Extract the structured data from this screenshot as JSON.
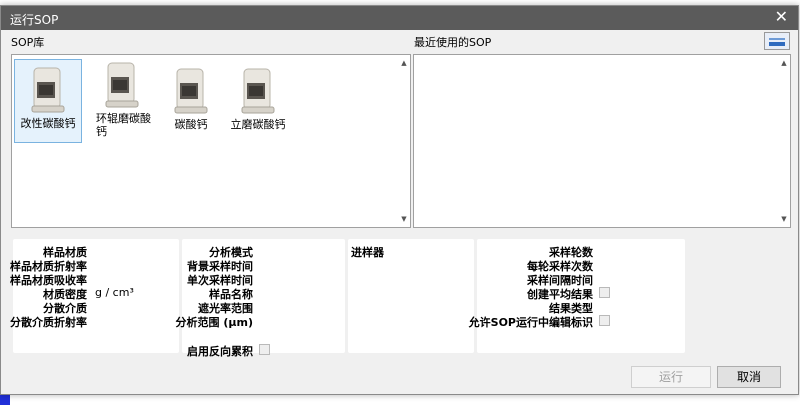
{
  "dialog": {
    "title": "运行SOP",
    "close_glyph": "✕"
  },
  "library": {
    "label": "SOP库",
    "items": [
      {
        "label": "改性碳酸钙",
        "icon": "instrument-icon",
        "selected": true
      },
      {
        "label": "环辊磨碳酸钙",
        "icon": "instrument-icon",
        "selected": false
      },
      {
        "label": "碳酸钙",
        "icon": "instrument-icon",
        "selected": false
      },
      {
        "label": "立磨碳酸钙",
        "icon": "instrument-icon",
        "selected": false
      }
    ]
  },
  "recent": {
    "label": "最近使用的SOP"
  },
  "sample_panel": {
    "labels": [
      "样品材质",
      "样品材质折射率",
      "样品材质吸收率",
      "材质密度",
      "分散介质",
      "分散介质折射率"
    ],
    "density_unit": "g / cm³"
  },
  "analysis_panel": {
    "labels": [
      "分析模式",
      "背景采样时间",
      "单次采样时间",
      "样品名称",
      "遮光率范围",
      "分析范围 (μm)"
    ],
    "reverse_label": "启用反向累积"
  },
  "sampler_panel": {
    "label": "进样器"
  },
  "measure_panel": {
    "labels": [
      "采样轮数",
      "每轮采样次数",
      "采样间隔时间",
      "创建平均结果",
      "结果类型",
      "允许SOP运行中编辑标识"
    ]
  },
  "buttons": {
    "run": "运行",
    "cancel": "取消"
  },
  "colors": {
    "titlebar": "#5b5b5b",
    "selection": "#e5f2fc",
    "accent": "#2f6bbf"
  }
}
